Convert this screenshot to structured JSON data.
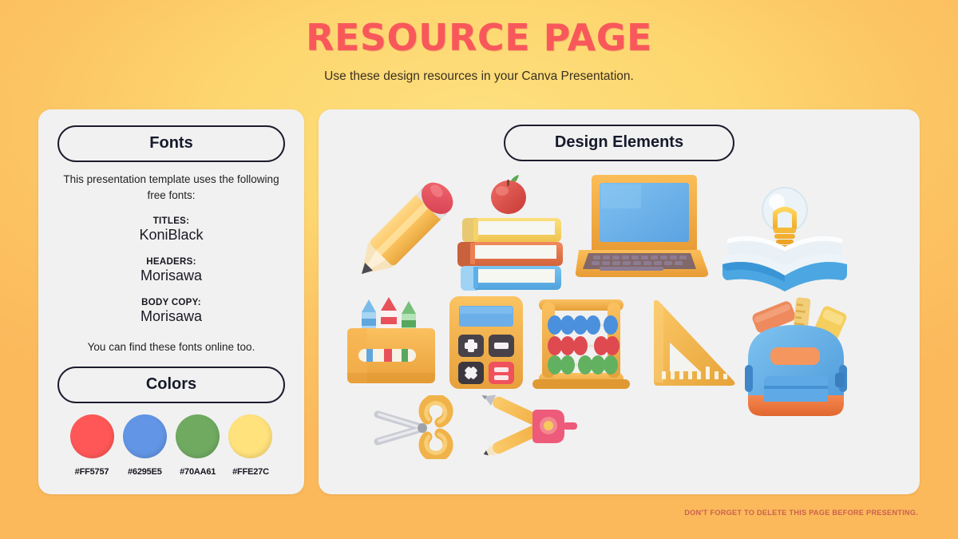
{
  "header": {
    "title": "RESOURCE PAGE",
    "subtitle": "Use these design resources in your Canva Presentation."
  },
  "fonts_panel": {
    "heading": "Fonts",
    "intro": "This presentation template uses the following free fonts:",
    "groups": [
      {
        "label": "TITLES:",
        "value": "KoniBlack"
      },
      {
        "label": "HEADERS:",
        "value": "Morisawa"
      },
      {
        "label": "BODY COPY:",
        "value": "Morisawa"
      }
    ],
    "outro": "You can find these fonts online too."
  },
  "colors_panel": {
    "heading": "Colors",
    "swatches": [
      {
        "hex": "#FF5757",
        "name": "red"
      },
      {
        "hex": "#6295E5",
        "name": "blue"
      },
      {
        "hex": "#70AA61",
        "name": "green"
      },
      {
        "hex": "#FFE27C",
        "name": "yellow"
      }
    ]
  },
  "design_panel": {
    "heading": "Design Elements",
    "elements": [
      {
        "name": "pencil-illustration",
        "label": "Pencil"
      },
      {
        "name": "books-apple-illustration",
        "label": "Stack of books with apple"
      },
      {
        "name": "laptop-illustration",
        "label": "Laptop"
      },
      {
        "name": "book-lightbulb-illustration",
        "label": "Open book with lightbulb"
      },
      {
        "name": "crayons-illustration",
        "label": "Box of crayons"
      },
      {
        "name": "calculator-illustration",
        "label": "Calculator"
      },
      {
        "name": "abacus-illustration",
        "label": "Abacus"
      },
      {
        "name": "ruler-triangle-illustration",
        "label": "Triangle ruler"
      },
      {
        "name": "backpack-illustration",
        "label": "Backpack"
      },
      {
        "name": "scissors-illustration",
        "label": "Scissors"
      },
      {
        "name": "compass-illustration",
        "label": "Drawing compass"
      }
    ]
  },
  "footer": {
    "note": "DON'T FORGET TO DELETE THIS PAGE BEFORE PRESENTING."
  },
  "theme": {
    "title_color": "#FF5757",
    "panel_bg": "#F1F1F1",
    "outline": "#1C1C2E",
    "bg_light": "#FDE07E",
    "bg_deep": "#FBB95C"
  }
}
